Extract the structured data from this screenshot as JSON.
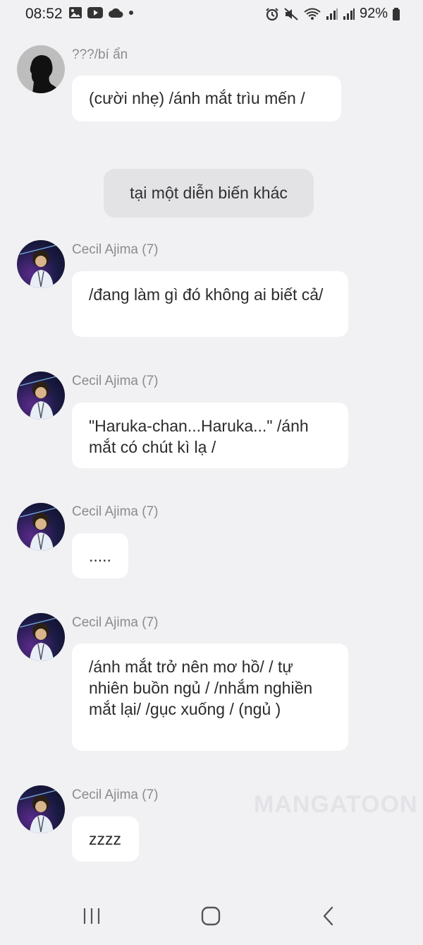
{
  "status_bar": {
    "time": "08:52",
    "battery": "92%",
    "left_icons": [
      "gallery-icon",
      "youtube-icon",
      "cloud-icon",
      "dot-icon"
    ],
    "right_icons": [
      "alarm-icon",
      "mute-icon",
      "wifi-icon",
      "signal-icon",
      "signal-icon",
      "battery-icon"
    ]
  },
  "messages": [
    {
      "sender": "???/bí ẩn",
      "text": "(cười nhẹ) /ánh mắt trìu mến /"
    },
    {
      "sender": "Cecil Ajima (7)",
      "text": "/đang làm gì đó không ai biết cả/"
    },
    {
      "sender": "Cecil Ajima (7)",
      "text": "\"Haruka-chan...Haruka...\" /ánh mắt có chút kì lạ /"
    },
    {
      "sender": "Cecil Ajima (7)",
      "text": "....."
    },
    {
      "sender": "Cecil Ajima (7)",
      "text": "/ánh mắt trở nên mơ hồ/ / tự nhiên buồn ngủ / /nhắm nghiền mắt lại/ /gục xuống / (ngủ )"
    },
    {
      "sender": "Cecil Ajima (7)",
      "text": "zzzz"
    }
  ],
  "narration": "tại một diễn biến khác",
  "watermark": "MANGATOON",
  "colors": {
    "background": "#f1f1f3",
    "bubble": "#ffffff",
    "narration_bg": "#e3e3e5",
    "sender_text": "#8b8b8f"
  }
}
